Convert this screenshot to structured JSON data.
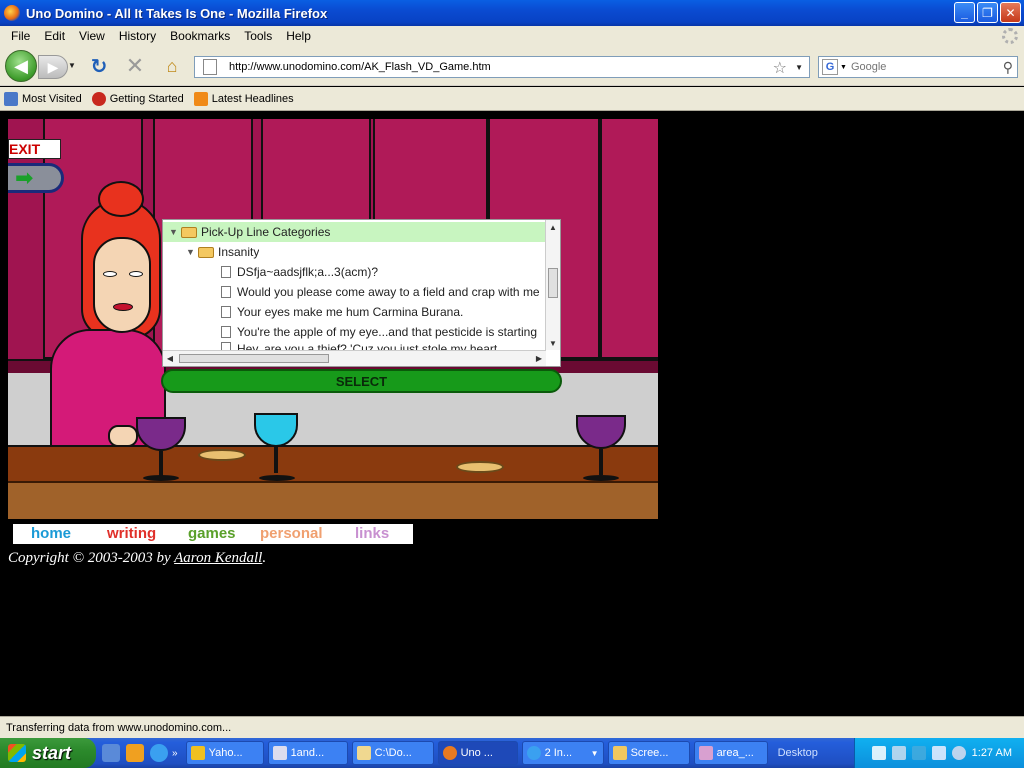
{
  "window": {
    "title": "Uno Domino - All It Takes Is One - Mozilla Firefox",
    "min": "_",
    "max": "❐",
    "close": "✕"
  },
  "menu": [
    "File",
    "Edit",
    "View",
    "History",
    "Bookmarks",
    "Tools",
    "Help"
  ],
  "nav": {
    "back": "◀",
    "forward": "▶",
    "url": "http://www.unodomino.com/AK_Flash_VD_Game.htm",
    "search_placeholder": "Google"
  },
  "bookmarks": [
    "Most Visited",
    "Getting Started",
    "Latest Headlines"
  ],
  "game": {
    "exit_label": "EXIT",
    "tree": {
      "root": "Pick-Up Line Categories",
      "category": "Insanity",
      "items": [
        "DSfja~aadsjflk;a...3(acm)?",
        "Would you please come away to a field and crap with me",
        "Your eyes make me hum Carmina Burana.",
        "You're the apple of my eye...and that pesticide is starting",
        "Hey, are you a thief? 'Cuz you just stole my heart."
      ]
    },
    "select_label": "SELECT"
  },
  "site_nav": {
    "items": [
      {
        "label": "home",
        "color": "#1a9ad6"
      },
      {
        "label": "writing",
        "color": "#e0302a"
      },
      {
        "label": "games",
        "color": "#5aa02a"
      },
      {
        "label": "personal",
        "color": "#f0a070"
      },
      {
        "label": "links",
        "color": "#c890d0"
      }
    ]
  },
  "copyright": {
    "prefix": "Copyright © 2003-2003 by ",
    "author": "Aaron Kendall",
    "suffix": "."
  },
  "status": "Transferring data from www.unodomino.com...",
  "taskbar": {
    "start": "start",
    "tasks": [
      "Yaho...",
      "1and...",
      "C:\\Do...",
      "Uno ...",
      "2 In...",
      "Scree...",
      "area_..."
    ],
    "desktop": "Desktop",
    "clock": "1:27 AM"
  }
}
